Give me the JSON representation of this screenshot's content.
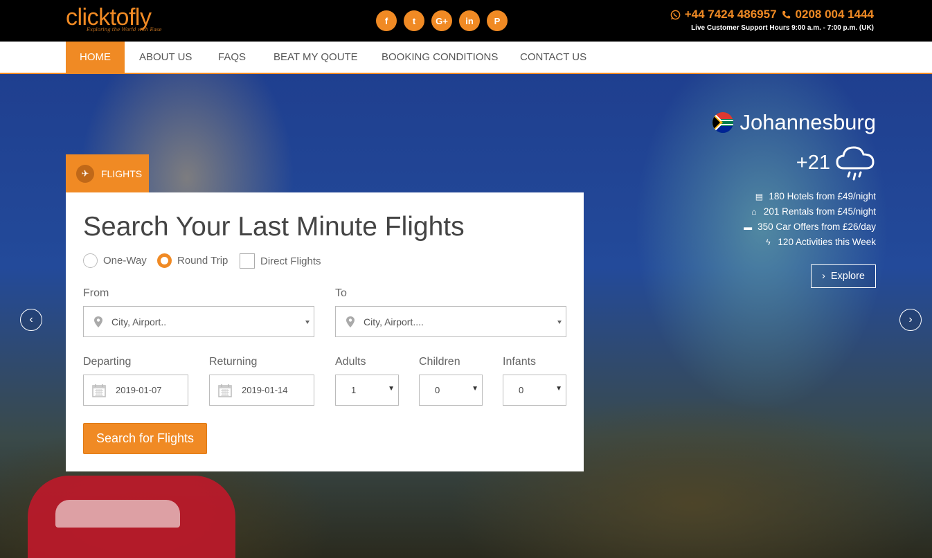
{
  "brand": {
    "logo_text": "clicktofly",
    "tagline": "Exploring the World with Ease"
  },
  "socials": [
    {
      "icon": "facebook-icon",
      "glyph": "f"
    },
    {
      "icon": "twitter-icon",
      "glyph": "t"
    },
    {
      "icon": "google-plus-icon",
      "glyph": "G+"
    },
    {
      "icon": "linkedin-icon",
      "glyph": "in"
    },
    {
      "icon": "pinterest-icon",
      "glyph": "P"
    }
  ],
  "contact": {
    "phone_whatsapp": "+44 7424 486957",
    "phone_landline": "0208 004 1444",
    "support_hours": "Live Customer Support Hours 9:00 a.m. - 7:00 p.m. (UK)"
  },
  "nav": {
    "items": [
      "HOME",
      "ABOUT US",
      "FAQS",
      "BEAT MY QOUTE",
      "BOOKING CONDITIONS",
      "CONTACT US"
    ],
    "active": "HOME"
  },
  "search": {
    "tab_label": "FLIGHTS",
    "title": "Search Your Last Minute Flights",
    "trip_options": [
      "One-Way",
      "Round Trip"
    ],
    "selected_trip": "Round Trip",
    "direct_label": "Direct Flights",
    "direct_checked": false,
    "from_label": "From",
    "from_placeholder": "City, Airport..",
    "to_label": "To",
    "to_placeholder": "City, Airport....",
    "departing_label": "Departing",
    "departing_value": "2019-01-07",
    "returning_label": "Returning",
    "returning_value": "2019-01-14",
    "adults_label": "Adults",
    "adults_value": "1",
    "children_label": "Children",
    "children_value": "0",
    "infants_label": "Infants",
    "infants_value": "0",
    "button_label": "Search for Flights"
  },
  "destination": {
    "city": "Johannesburg",
    "temperature": "+21",
    "weather_icon": "rain-cloud-icon",
    "stats": [
      {
        "icon": "building-icon",
        "text": "180 Hotels from £49/night"
      },
      {
        "icon": "home-icon",
        "text": "201 Rentals from £45/night"
      },
      {
        "icon": "car-icon",
        "text": "350 Car Offers from £26/day"
      },
      {
        "icon": "bolt-icon",
        "text": "120 Activities this Week"
      }
    ],
    "explore_label": "Explore"
  },
  "colors": {
    "accent": "#f08a24",
    "topbar": "#000000",
    "nav_bg": "#ffffff"
  }
}
